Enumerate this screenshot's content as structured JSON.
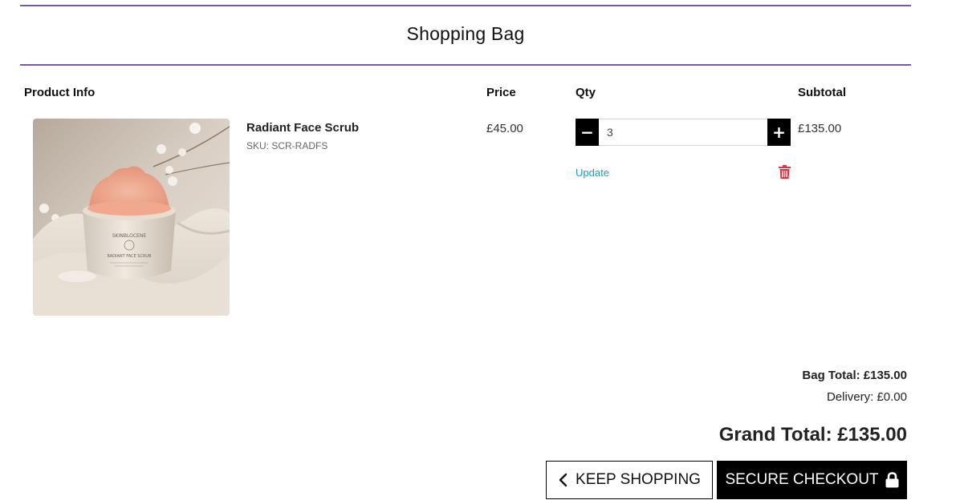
{
  "page": {
    "title": "Shopping Bag"
  },
  "table": {
    "headers": {
      "product": "Product Info",
      "price": "Price",
      "qty": "Qty",
      "subtotal": "Subtotal"
    }
  },
  "items": [
    {
      "name": "Radiant Face Scrub",
      "sku": "SKU: SCR-RADFS",
      "price": "£45.00",
      "qty": "3",
      "subtotal": "£135.00",
      "update_label": "Update",
      "image_icon": "product-jar-image",
      "jar_text_brand": "SKINBLOCENE",
      "jar_text_name": "RADIANT FACE SCRUB"
    }
  ],
  "qty_controls": {
    "minus_label": "−",
    "plus_label": "+"
  },
  "totals": {
    "bag_total": "Bag Total: £135.00",
    "delivery": "Delivery: £0.00",
    "grand_total": "Grand Total: £135.00"
  },
  "actions": {
    "keep_shopping": "KEEP SHOPPING",
    "secure_checkout": "SECURE CHECKOUT"
  },
  "colors": {
    "accent_rule": "#7a5aa6",
    "link": "#17a2b8",
    "delete": "#dc3545",
    "button_dark": "#000000"
  }
}
